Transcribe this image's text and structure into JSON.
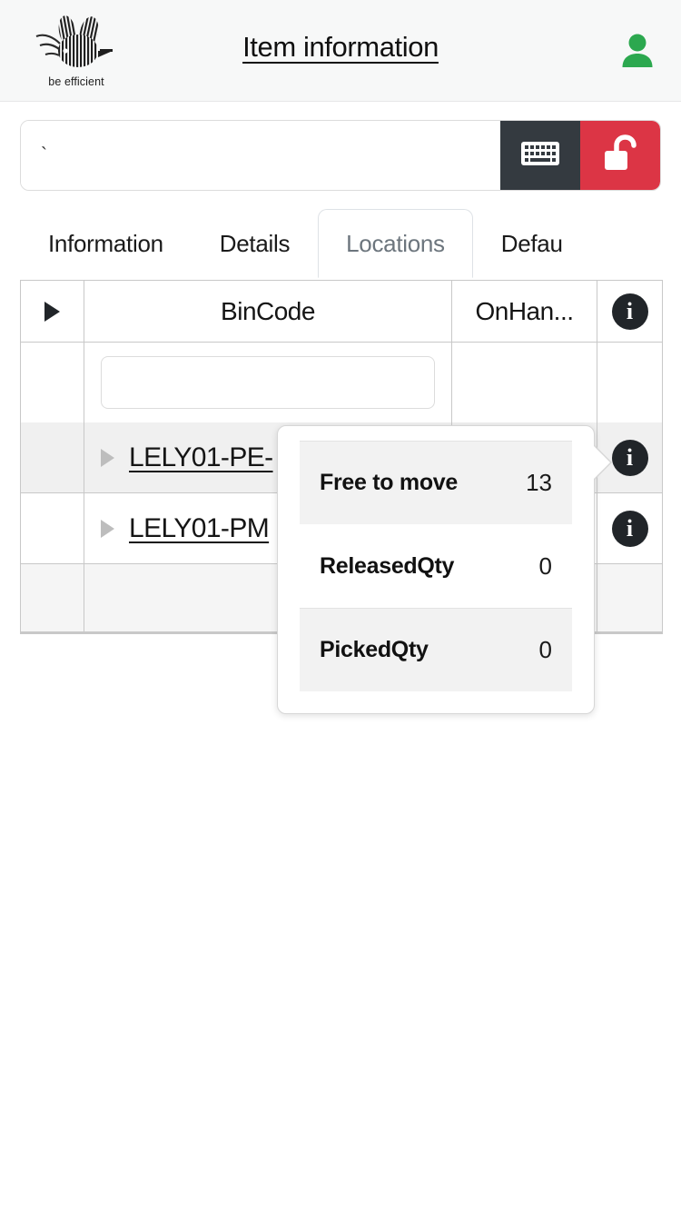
{
  "header": {
    "title": "Item information",
    "logo_tagline": "be efficient",
    "logo_icon": "bee-barcode-logo",
    "user_icon": "user-person-icon",
    "user_icon_color": "#2ca84f"
  },
  "search": {
    "value": "`",
    "placeholder": "",
    "keyboard_button": {
      "icon": "keyboard-icon",
      "background": "#343a40"
    },
    "unlock_button": {
      "icon": "unlock-icon",
      "background": "#dc3545"
    }
  },
  "tabs": {
    "items": [
      {
        "label": "Information",
        "active": false
      },
      {
        "label": "Details",
        "active": false
      },
      {
        "label": "Locations",
        "active": true
      },
      {
        "label": "Defau",
        "active": false
      }
    ]
  },
  "grid": {
    "columns": [
      {
        "key": "expand",
        "header": "",
        "icon": "expand-caret-icon"
      },
      {
        "key": "bincode",
        "header": "BinCode"
      },
      {
        "key": "onhand",
        "header": "OnHan..."
      },
      {
        "key": "info",
        "header": "",
        "icon": "info-icon"
      }
    ],
    "filter_row": {
      "bincode_value": "",
      "bincode_placeholder": ""
    },
    "rows": [
      {
        "bincode": "LELY01-PE-",
        "onhand": "",
        "info_icon": "info-icon"
      },
      {
        "bincode": "LELY01-PM",
        "onhand": "",
        "info_icon": "info-icon"
      }
    ],
    "footer_row": {
      "bincode": "",
      "onhand": ""
    }
  },
  "popover": {
    "rows": [
      {
        "label": "Free to move",
        "value": "13"
      },
      {
        "label": "ReleasedQty",
        "value": "0"
      },
      {
        "label": "PickedQty",
        "value": "0"
      }
    ]
  }
}
